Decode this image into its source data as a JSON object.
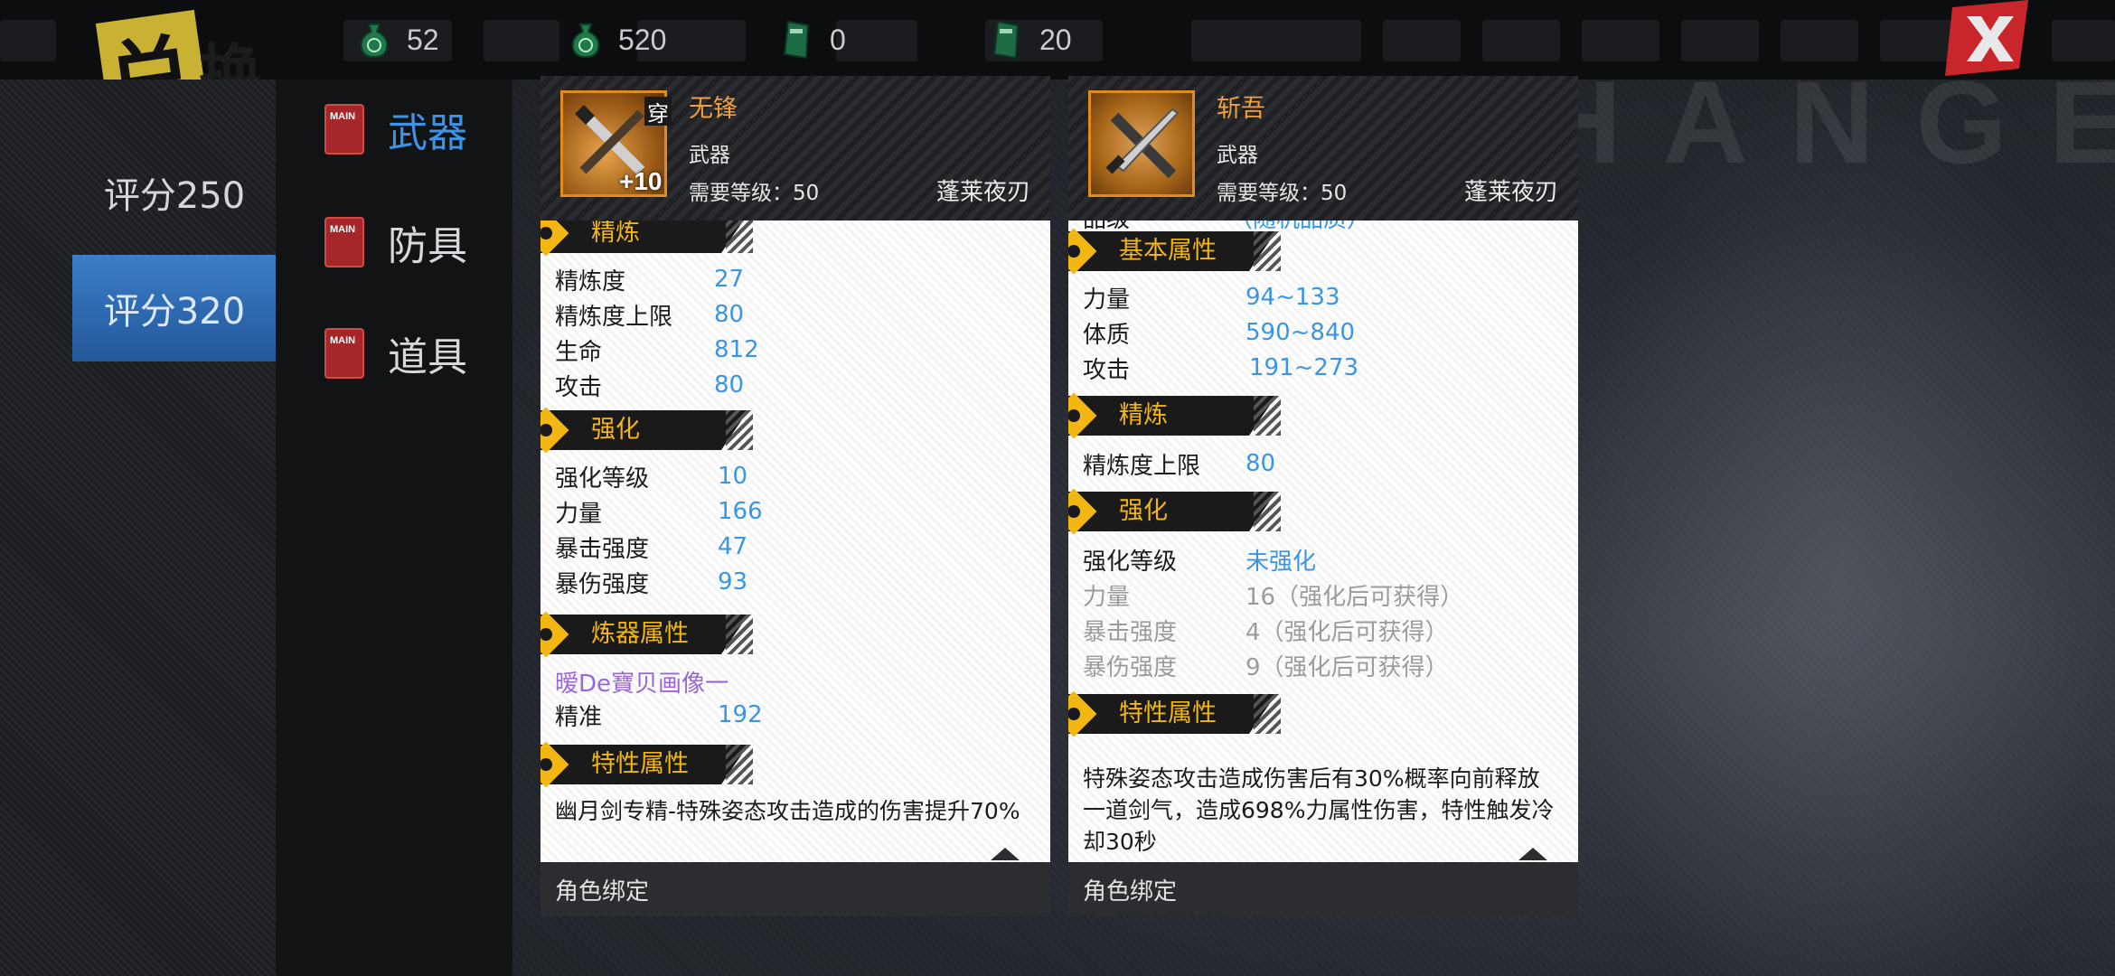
{
  "logo": {
    "char1": "兑",
    "char2": "换"
  },
  "watermark": "HANGE",
  "currencies": [
    {
      "icon": "green-coin-bag-icon",
      "value": "52"
    },
    {
      "icon": "green-coin-bag-icon",
      "value": "520"
    },
    {
      "icon": "green-ticket-icon",
      "value": "0"
    },
    {
      "icon": "green-ticket-icon",
      "value": "20"
    }
  ],
  "close_label": "X",
  "scores": [
    {
      "label": "评分250",
      "active": false
    },
    {
      "label": "评分320",
      "active": true
    }
  ],
  "categories": [
    {
      "icon_text": "MAIN",
      "label": "武器",
      "active": true
    },
    {
      "icon_text": "MAIN",
      "label": "防具",
      "active": false
    },
    {
      "icon_text": "MAIN",
      "label": "道具",
      "active": false
    }
  ],
  "cards": [
    {
      "name": "无锋",
      "tag": "穿",
      "plus": "+10",
      "type": "武器",
      "requirement": "需要等级：50",
      "set": "蓬莱夜刃",
      "sections": {
        "refine": {
          "title": "精炼",
          "rows": [
            {
              "k": "精炼度",
              "v": "27"
            },
            {
              "k": "精炼度上限",
              "v": "80"
            },
            {
              "k": "生命",
              "v": "812"
            },
            {
              "k": "攻击",
              "v": "80"
            }
          ]
        },
        "enhance": {
          "title": "强化",
          "rows": [
            {
              "k": "强化等级",
              "v": "10"
            },
            {
              "k": "力量",
              "v": "166"
            },
            {
              "k": "暴击强度",
              "v": "47"
            },
            {
              "k": "暴伤强度",
              "v": "93"
            }
          ]
        },
        "forge": {
          "title": "炼器属性",
          "maker": "暧De寶贝画像一",
          "rows": [
            {
              "k": "精准",
              "v": "192"
            }
          ]
        },
        "trait": {
          "title": "特性属性",
          "text": "幽月剑专精-特殊姿态攻击造成的伤害提升70%"
        }
      },
      "footer": "角色绑定"
    },
    {
      "name": "斩吾",
      "type": "武器",
      "requirement": "需要等级：50",
      "set": "蓬莱夜刃",
      "partial_row": {
        "k": "品级",
        "v": "（随机品质）"
      },
      "sections": {
        "basic": {
          "title": "基本属性",
          "rows": [
            {
              "k": "力量",
              "v": "94~133"
            },
            {
              "k": "体质",
              "v": "590~840"
            },
            {
              "k": "攻击",
              "v": "191~273"
            }
          ]
        },
        "refine": {
          "title": "精炼",
          "rows": [
            {
              "k": "精炼度上限",
              "v": "80"
            }
          ]
        },
        "enhance": {
          "title": "强化",
          "rows": [
            {
              "k": "强化等级",
              "v": "未强化"
            },
            {
              "k": "力量",
              "v": "16（强化后可获得）"
            },
            {
              "k": "暴击强度",
              "v": "4（强化后可获得）"
            },
            {
              "k": "暴伤强度",
              "v": "9（强化后可获得）"
            }
          ]
        },
        "trait": {
          "title": "特性属性",
          "text": "特殊姿态攻击造成伤害后有30%概率向前释放一道剑气，造成698%力属性伤害，特性触发冷却30秒"
        }
      },
      "footer": "角色绑定"
    }
  ],
  "colors": {
    "accent_blue": "#3a95e4",
    "section_yellow": "#f3b613",
    "item_name_orange": "#f0a040",
    "maker_purple": "#9a66d8",
    "close_red": "#c8262a"
  }
}
